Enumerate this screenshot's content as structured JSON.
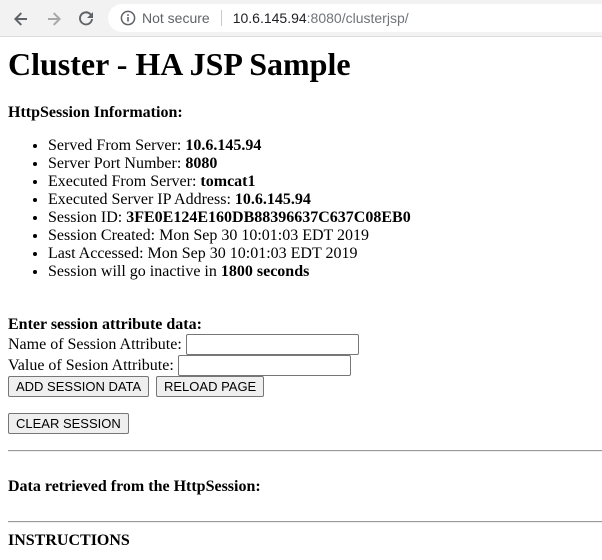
{
  "browser": {
    "security_label": "Not secure",
    "url_host": "10.6.145.94",
    "url_rest": ":8080/clusterjsp/"
  },
  "page": {
    "title": "Cluster - HA JSP Sample",
    "session_info_heading": "HttpSession Information:",
    "info_items": [
      {
        "label": "Served From Server: ",
        "value": "10.6.145.94"
      },
      {
        "label": "Server Port Number: ",
        "value": "8080"
      },
      {
        "label": "Executed From Server: ",
        "value": "tomcat1"
      },
      {
        "label": "Executed Server IP Address: ",
        "value": "10.6.145.94"
      },
      {
        "label": "Session ID: ",
        "value": "3FE0E124E160DB88396637C637C08EB0"
      },
      {
        "label": "Session Created: Mon Sep 30 10:01:03 EDT 2019",
        "value": ""
      },
      {
        "label": "Last Accessed: Mon Sep 30 10:01:03 EDT 2019",
        "value": ""
      },
      {
        "label": "Session will go inactive in ",
        "value": "1800 seconds"
      }
    ],
    "form": {
      "heading": "Enter session attribute data:",
      "name_label": "Name of Session Attribute:",
      "name_value": "",
      "value_label": "Value of Sesion Attribute:",
      "value_value": "",
      "add_button": "ADD SESSION DATA",
      "reload_button": "RELOAD PAGE",
      "clear_button": "CLEAR SESSION"
    },
    "retrieved_heading": "Data retrieved from the HttpSession:",
    "instructions_heading": "INSTRUCTIONS"
  }
}
